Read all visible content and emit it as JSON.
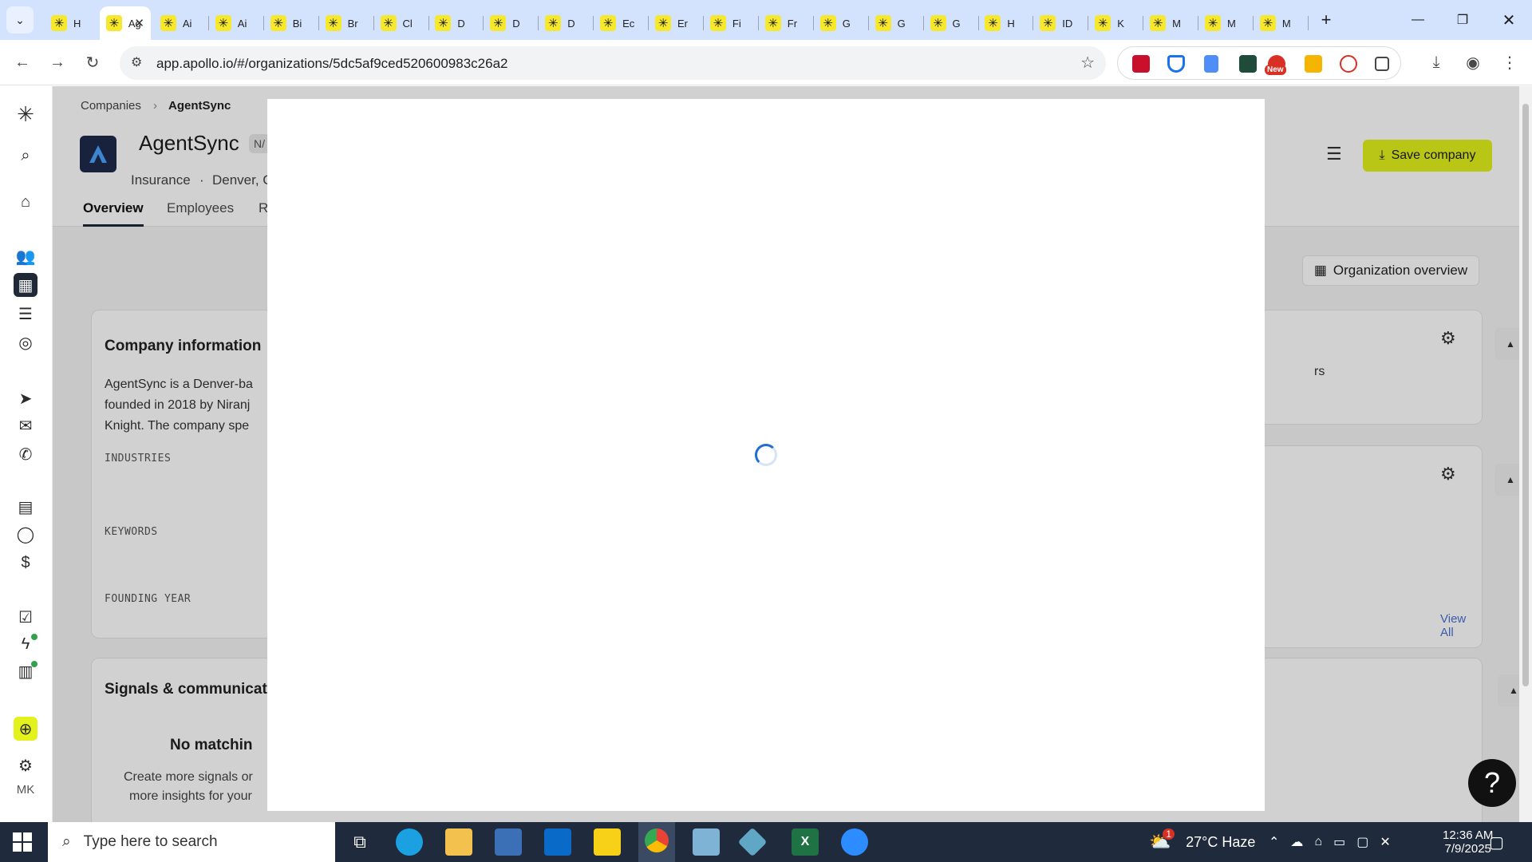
{
  "browser": {
    "tabs": [
      {
        "label": "H"
      },
      {
        "label": "Ag",
        "active": true
      },
      {
        "label": "Ai"
      },
      {
        "label": "Ai"
      },
      {
        "label": "Bi"
      },
      {
        "label": "Br"
      },
      {
        "label": "Cl"
      },
      {
        "label": "D"
      },
      {
        "label": "D"
      },
      {
        "label": "D"
      },
      {
        "label": "Ec"
      },
      {
        "label": "Er"
      },
      {
        "label": "Fi"
      },
      {
        "label": "Fr"
      },
      {
        "label": "G"
      },
      {
        "label": "G"
      },
      {
        "label": "G"
      },
      {
        "label": "H"
      },
      {
        "label": "ID"
      },
      {
        "label": "K"
      },
      {
        "label": "M"
      },
      {
        "label": "M"
      },
      {
        "label": "M"
      }
    ],
    "url": "app.apollo.io/#/organizations/5dc5af9ced520600983c26a2",
    "new_badge": "New"
  },
  "breadcrumb": {
    "parent": "Companies",
    "current": "AgentSync"
  },
  "company": {
    "name": "AgentSync",
    "badge": "N/",
    "industry": "Insurance",
    "location": "Denver, C"
  },
  "page_tabs": [
    "Overview",
    "Employees",
    "R"
  ],
  "actions": {
    "save": "Save company",
    "org_overview": "Organization overview"
  },
  "company_info": {
    "title": "Company information",
    "description_lines": [
      "AgentSync is a Denver-ba",
      "founded in 2018 by Niranj",
      "Knight. The company spe"
    ],
    "industries_label": "INDUSTRIES",
    "keywords_label": "KEYWORDS",
    "founding_label": "FOUNDING YEAR",
    "right_fragment": "rs"
  },
  "signals": {
    "title": "Signals & communicat",
    "empty_title": "No matchin",
    "empty_desc_1": "Create more signals or",
    "empty_desc_2": "more insights for your"
  },
  "view_all": "View All",
  "user_initials": "MK",
  "help_label": "?",
  "taskbar": {
    "search_placeholder": "Type here to search",
    "weather": "27°C  Haze",
    "time": "12:36 AM",
    "date": "7/9/2025",
    "weather_badge": "1"
  }
}
